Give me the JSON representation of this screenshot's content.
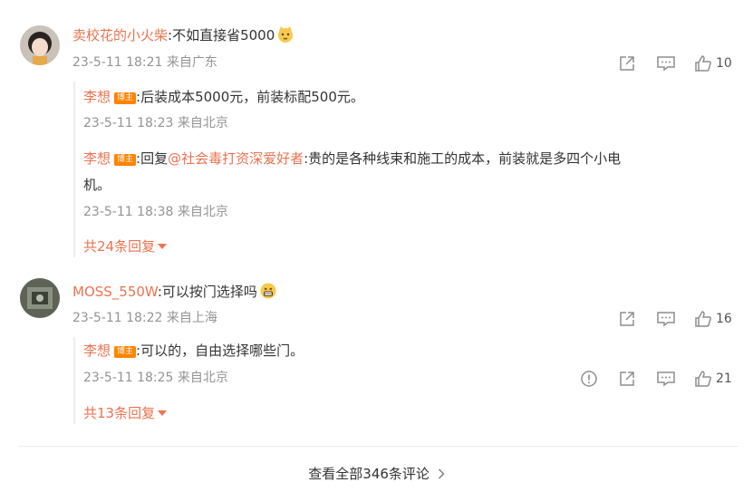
{
  "comments": [
    {
      "username": "卖校花的小火柴",
      "text": ":不如直接省5000",
      "meta": "23-5-11 18:21 来自广东",
      "likes": "10",
      "replies": [
        {
          "username": "李想",
          "badge": "博主",
          "text": ":后装成本5000元，前装标配500元。",
          "meta": "23-5-11 18:23 来自北京"
        },
        {
          "username": "李想",
          "badge": "博主",
          "prefix": ":回复",
          "mention": "@社会毒打资深爱好者",
          "text_line1": ":贵的是各种线束和施工的成本，前装就是多四个小电",
          "text_line2": "机。",
          "meta": "23-5-11 18:38 来自北京"
        }
      ],
      "more_replies": "共24条回复"
    },
    {
      "username": "MOSS_550W",
      "text": ":可以按门选择吗",
      "meta": "23-5-11 18:22 来自上海",
      "likes": "16",
      "replies": [
        {
          "username": "李想",
          "badge": "博主",
          "text": ":可以的，自由选择哪些门。",
          "meta": "23-5-11 18:25 来自北京",
          "likes": "21"
        }
      ],
      "more_replies": "共13条回复"
    }
  ],
  "view_all": "查看全部346条评论",
  "icons": [
    "share-icon",
    "comment-icon",
    "like-icon",
    "report-icon",
    "chevron-right-icon",
    "caret-down-icon",
    "emoji-icon"
  ],
  "colors": {
    "username": "#eb7350",
    "badge": "#ff8200",
    "meta": "#939393"
  }
}
